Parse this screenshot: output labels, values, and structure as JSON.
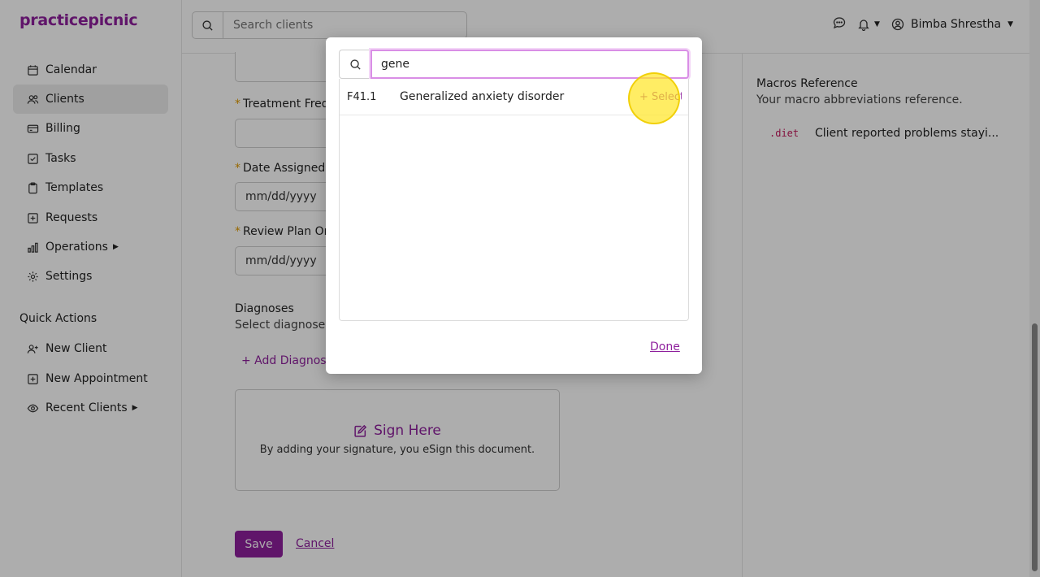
{
  "app": {
    "logo": "practicepicnic"
  },
  "sidebar": {
    "items": [
      {
        "label": "Calendar",
        "icon": "calendar-icon"
      },
      {
        "label": "Clients",
        "icon": "users-icon",
        "active": true
      },
      {
        "label": "Billing",
        "icon": "credit-card-icon"
      },
      {
        "label": "Tasks",
        "icon": "checkbox-icon"
      },
      {
        "label": "Templates",
        "icon": "clipboard-icon"
      },
      {
        "label": "Requests",
        "icon": "plus-square-icon"
      },
      {
        "label": "Operations",
        "icon": "bar-chart-icon",
        "has_submenu": true
      },
      {
        "label": "Settings",
        "icon": "gear-icon"
      }
    ],
    "quick_actions_title": "Quick Actions",
    "quick_actions": [
      {
        "label": "New Client",
        "icon": "user-plus-icon"
      },
      {
        "label": "New Appointment",
        "icon": "plus-square-icon"
      },
      {
        "label": "Recent Clients",
        "icon": "eye-icon",
        "has_submenu": true
      }
    ]
  },
  "topbar": {
    "search_placeholder": "Search clients",
    "user_name": "Bimba Shrestha"
  },
  "form": {
    "treatment_freq_label": "Treatment Freq",
    "date_assigned_label": "Date Assigned t",
    "date_assigned_value": "mm/dd/yyyy",
    "review_plan_label": "Review Plan On",
    "review_plan_value": "mm/dd/yyyy",
    "diagnoses_title": "Diagnoses",
    "diagnoses_sub": "Select diagnoses",
    "add_diagnosis": "+ Add Diagnosis",
    "sign_title": "Sign Here",
    "sign_sub": "By adding your signature, you eSign this document.",
    "save_label": "Save",
    "cancel_label": "Cancel"
  },
  "right_panel": {
    "title": "Macros Reference",
    "subtitle": "Your macro abbreviations reference.",
    "macros": [
      {
        "code": ".diet",
        "text": "Client reported problems stayi..."
      }
    ]
  },
  "modal": {
    "search_value": "gene",
    "results": [
      {
        "code": "F41.1",
        "name": "Generalized anxiety disorder",
        "action": "+ Select"
      }
    ],
    "done_label": "Done"
  },
  "colors": {
    "brand": "#8e1f9c",
    "required": "#e09a00",
    "macro_code": "#c2185b"
  }
}
